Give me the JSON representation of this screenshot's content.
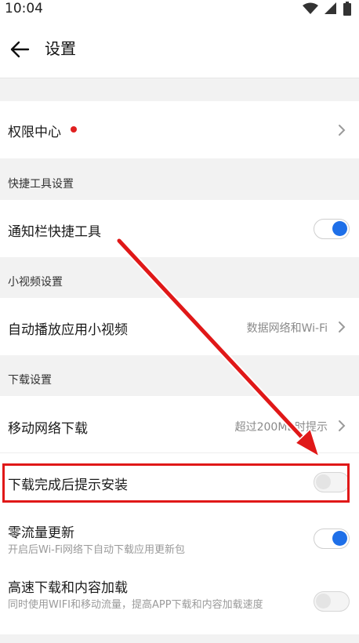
{
  "status_bar": {
    "time": "10:04"
  },
  "header": {
    "title": "设置"
  },
  "permission": {
    "label": "权限中心"
  },
  "sections": {
    "shortcut": "快捷工具设置",
    "video": "小视频设置",
    "download": "下载设置"
  },
  "settings": {
    "notify_tool": {
      "label": "通知栏快捷工具",
      "enabled": true
    },
    "autoplay_video": {
      "label": "自动播放应用小视频",
      "value": "数据网络和Wi-Fi"
    },
    "mobile_download": {
      "label": "移动网络下载",
      "value": "超过200MB时提示"
    },
    "install_prompt": {
      "label": "下载完成后提示安装",
      "enabled": false
    },
    "zero_traffic": {
      "label": "零流量更新",
      "desc": "开启后Wi-Fi网络下自动下载应用更新包",
      "enabled": true
    },
    "high_speed": {
      "label": "高速下载和内容加载",
      "desc": "同时使用WIFI和移动流量，提高APP下载和内容加载速度",
      "enabled": false
    }
  },
  "colors": {
    "accent": "#1e6fe8",
    "annotation": "#e01818",
    "badge": "#e02020"
  }
}
